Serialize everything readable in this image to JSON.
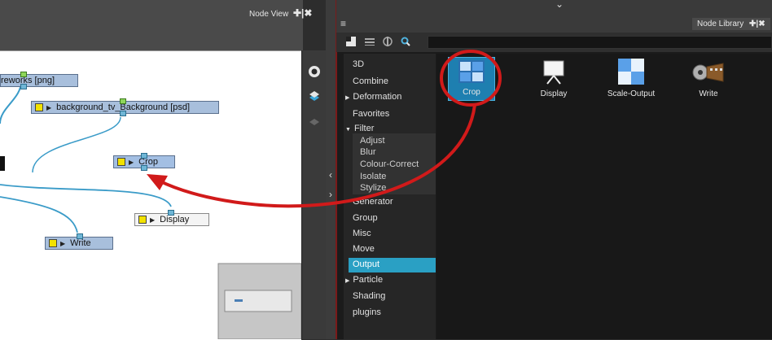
{
  "node_view": {
    "tab_label": "Node View",
    "tab_icons": "✚|✖",
    "nodes": [
      {
        "label": "reworks [png]"
      },
      {
        "label": "background_tv_Background [psd]"
      },
      {
        "label": "Crop"
      },
      {
        "label": "Display"
      },
      {
        "label": "Write"
      }
    ]
  },
  "node_library": {
    "tab_label": "Node Library",
    "tab_icons": "✚|✖",
    "categories": [
      {
        "label": "3D"
      },
      {
        "label": "Combine"
      },
      {
        "label": "Deformation"
      },
      {
        "label": "Favorites"
      },
      {
        "label": "Filter"
      },
      {
        "label": "Adjust"
      },
      {
        "label": "Blur"
      },
      {
        "label": "Colour-Correct"
      },
      {
        "label": "Isolate"
      },
      {
        "label": "Stylize"
      },
      {
        "label": "Generator"
      },
      {
        "label": "Group"
      },
      {
        "label": "Misc"
      },
      {
        "label": "Move"
      },
      {
        "label": "Output"
      },
      {
        "label": "Particle"
      },
      {
        "label": "Shading"
      },
      {
        "label": "plugins"
      }
    ],
    "selected_category": "Output",
    "items": [
      {
        "label": "Crop",
        "icon": "crop-node-icon"
      },
      {
        "label": "Display",
        "icon": "display-node-icon"
      },
      {
        "label": "Scale-Output",
        "icon": "scale-output-node-icon"
      },
      {
        "label": "Write",
        "icon": "write-node-icon"
      }
    ]
  },
  "colors": {
    "node_fill": "#a8bfdc",
    "selected_category": "#2aa0c4",
    "annotation_red": "#d11a1a",
    "cable": "#3a9bc8"
  }
}
